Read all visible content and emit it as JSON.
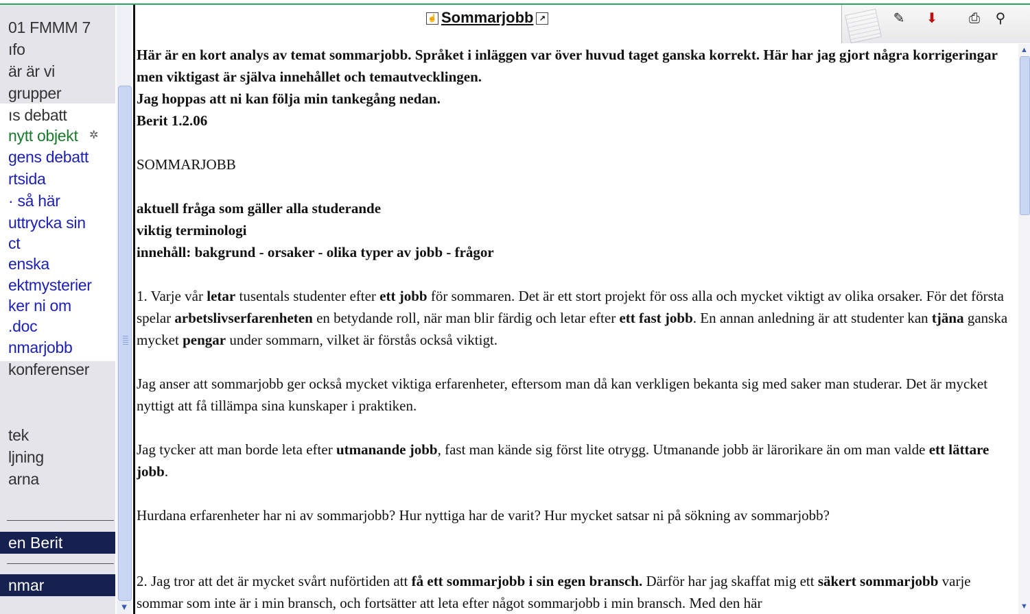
{
  "sidebar": {
    "items": [
      {
        "label": "01 FMMM 7",
        "color": "dark"
      },
      {
        "label": "ıfo",
        "color": "dark"
      },
      {
        "label": "är är vi",
        "color": "dark"
      },
      {
        "label": "grupper",
        "color": "dark"
      },
      {
        "label": "ıs debatt",
        "color": "dark"
      },
      {
        "label": "nytt objekt",
        "color": "green"
      },
      {
        "label": "gens debatt",
        "color": "blue"
      },
      {
        "label": "rtsida",
        "color": "blue"
      },
      {
        "label": "· så här",
        "color": "blue"
      },
      {
        "label": "uttrycka sin",
        "color": "blue"
      },
      {
        "label": "ct",
        "color": "blue"
      },
      {
        "label": "enska",
        "color": "blue"
      },
      {
        "label": "ektmysterier",
        "color": "blue"
      },
      {
        "label": "ker ni om",
        "color": "blue"
      },
      {
        "label": ".doc",
        "color": "blue"
      },
      {
        "label": "nmarjobb",
        "color": "blue"
      },
      {
        "label": "konferenser",
        "color": "dark"
      },
      {
        "label": "tek",
        "color": "dark"
      },
      {
        "label": "ljning",
        "color": "dark"
      },
      {
        "label": "arna",
        "color": "dark"
      }
    ],
    "dark_items": [
      "en Berit",
      "nmar"
    ]
  },
  "header": {
    "title": "Sommarjobb",
    "toolbar_icons": [
      "edit-icon",
      "save-icon",
      "print-icon",
      "search-icon"
    ]
  },
  "content": {
    "intro": [
      "Här är en kort analys av temat sommarjobb. Språket i inläggen var över huvud taget ganska korrekt. Här har jag gjort några korrigeringar men viktigast är själva innehållet och temautvecklingen.",
      "Jag hoppas att ni kan följa min tankegång nedan.",
      "Berit 1.2.06"
    ],
    "heading": "SOMMARJOBB",
    "topics": [
      "aktuell fråga som gäller alla studerande",
      "viktig terminologi",
      "innehåll: bakgrund - orsaker - olika typer av jobb - frågor"
    ],
    "p1": {
      "a": "1. Varje vår ",
      "b1": "letar",
      "c": " tusentals studenter efter ",
      "b2": "ett jobb",
      "d": " för sommaren. Det är ett stort projekt för oss alla och mycket viktigt av olika orsaker. För det första spelar ",
      "b3": "arbetslivserfarenheten",
      "e": " en betydande roll, när man blir färdig och letar efter ",
      "b4": "ett fast jobb",
      "f": ". En annan anledning är att studenter kan ",
      "b5": "tjäna",
      "g": " ganska mycket ",
      "b6": "pengar",
      "h": " under sommarn, vilket är förstås också viktigt."
    },
    "p2": "Jag anser att sommarjobb ger också mycket viktiga erfarenheter, eftersom man då kan verkligen bekanta sig med saker man studerar. Det är mycket nyttigt att få tillämpa sina kunskaper i praktiken.",
    "p3": {
      "a": "Jag tycker att man borde leta efter ",
      "b1": "utmanande jobb",
      "c": ", fast man kände sig först lite otrygg. Utmanande jobb är lärorikare än om man valde ",
      "b2": "ett lättare jobb",
      "d": "."
    },
    "p4": "Hurdana erfarenheter har ni av sommarjobb? Hur nyttiga har de varit? Hur mycket satsar ni på sökning av sommarjobb?",
    "p5": {
      "a": "2. Jag tror att det är mycket svårt nuförtiden att ",
      "b1": "få ett sommarjobb i sin egen bransch.",
      "c": " Därför har jag skaffat mig ett ",
      "b2": "säkert sommarjobb",
      "d": " varje sommar som inte är i min bransch, och fortsätter att leta efter något sommarjobb i min bransch. Med den här"
    }
  }
}
